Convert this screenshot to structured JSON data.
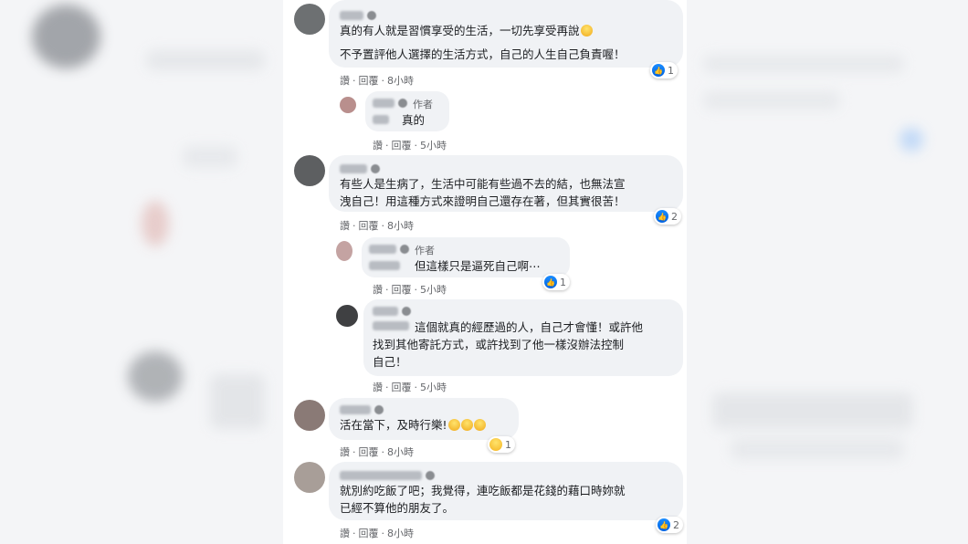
{
  "comments": [
    {
      "author_badge": "",
      "lines": "真的有人就是習慣享受的生活，一切先享受再說",
      "lines2": "不予置評他人選擇的生活方式，自己的人生自己負責喔！",
      "actions": [
        "讚",
        "回覆",
        "8小時"
      ],
      "reactions": "1"
    },
    {
      "author_badge": "作者",
      "lines": "真的",
      "actions": [
        "讚",
        "回覆",
        "5小時"
      ]
    },
    {
      "author_badge": "",
      "lines": "有些人是生病了，生活中可能有些過不去的結，也無法宣\n洩自己！用這種方式來證明自己還存在著，但其實很苦！",
      "actions": [
        "讚",
        "回覆",
        "8小時"
      ],
      "reactions": "2"
    },
    {
      "author_badge": "作者",
      "lines": "但這樣只是逼死自己啊⋯",
      "actions": [
        "讚",
        "回覆",
        "5小時"
      ],
      "reactions": "1"
    },
    {
      "author_badge": "",
      "lines": "這個就真的經歷過的人，自己才會懂！或許他\n找到其他寄託方式，或許找到了他一樣沒辦法控制\n自己！",
      "actions": [
        "讚",
        "回覆",
        "5小時"
      ]
    },
    {
      "author_badge": "",
      "lines": "活在當下，及時行樂!",
      "actions": [
        "讚",
        "回覆",
        "8小時"
      ],
      "reactions": "1"
    },
    {
      "author_badge": "",
      "lines": "就別約吃飯了吧；我覺得，連吃飯都是花錢的藉口時妳就\n已經不算他的朋友了。",
      "actions": [
        "讚",
        "回覆",
        "8小時"
      ],
      "reactions": "2"
    }
  ],
  "colors": {
    "like": "#1877f2",
    "bubble": "#f0f2f5",
    "text": "#1c1e21",
    "meta": "#65676b"
  }
}
